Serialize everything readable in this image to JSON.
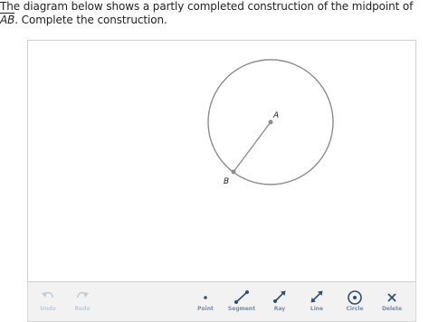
{
  "prompt": {
    "text_before": "The diagram below shows a partly completed construction of the midpoint of ",
    "segment_name": "AB",
    "text_after": ". Complete the construction."
  },
  "canvas": {
    "points": [
      {
        "label": "A"
      },
      {
        "label": "B"
      }
    ]
  },
  "toolbar": {
    "undo_label": "Undo",
    "redo_label": "Redo",
    "point_label": "Point",
    "segment_label": "Segment",
    "ray_label": "Ray",
    "line_label": "Line",
    "circle_label": "Circle",
    "delete_label": "Delete"
  },
  "colors": {
    "geometry": "#8c8c8c",
    "tool_icon": "#2f4f6f",
    "tool_label": "#7a8ca0",
    "disabled": "#c2ccd6",
    "toolbar_bg": "#f2f2f2"
  }
}
